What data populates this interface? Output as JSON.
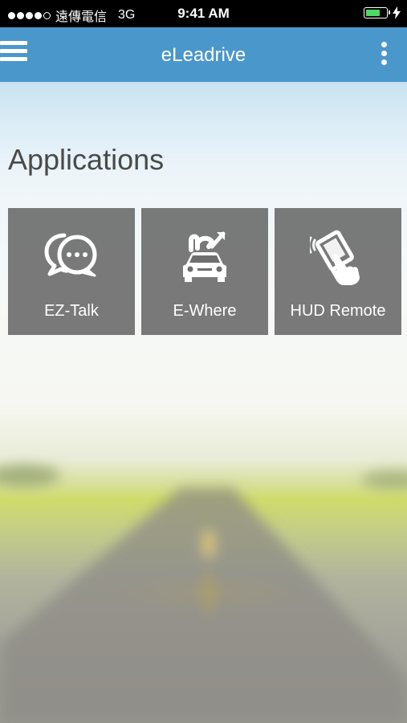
{
  "status_bar": {
    "carrier": "遠傳電信",
    "network": "3G",
    "time": "9:41 AM",
    "signal_filled": 4,
    "signal_total": 5,
    "battery_level": 0.75,
    "charging": true
  },
  "navbar": {
    "title": "eLeadrive",
    "menu_icon": "hamburger-menu-icon",
    "more_icon": "more-vertical-icon",
    "color": "#4a97cb"
  },
  "main": {
    "section_title": "Applications",
    "apps": [
      {
        "label": "EZ-Talk",
        "icon": "chat-bubbles-icon"
      },
      {
        "label": "E-Where",
        "icon": "car-location-icon"
      },
      {
        "label": "HUD Remote",
        "icon": "hand-phone-icon"
      }
    ]
  }
}
